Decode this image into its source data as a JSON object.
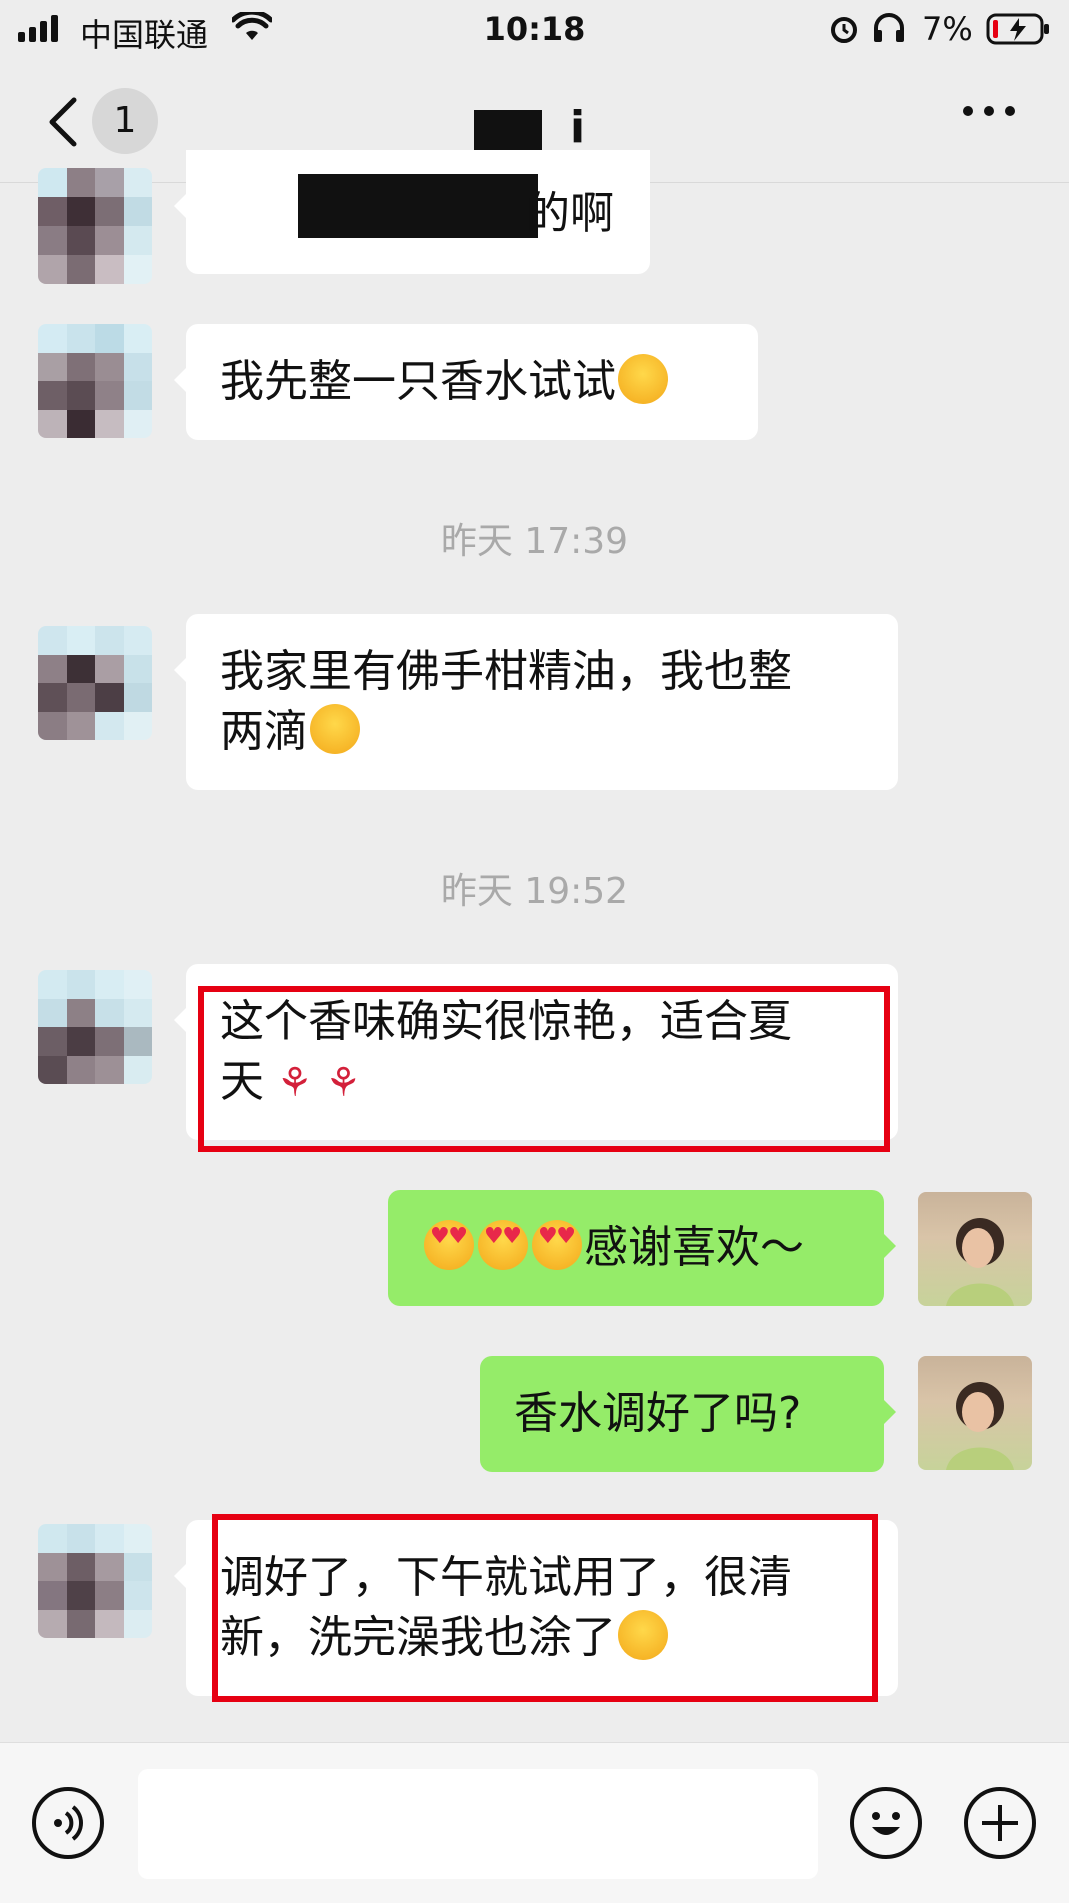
{
  "status_bar": {
    "carrier": "中国联通",
    "time": "10:18",
    "battery": "7%"
  },
  "nav": {
    "unread_count": "1",
    "title": "i",
    "more_label": "•••"
  },
  "messages": [
    {
      "side": "left",
      "text": "的啊",
      "redacted": true
    },
    {
      "side": "left",
      "text": "我先整一只香水试试",
      "emoji": "grin"
    },
    {
      "type": "time",
      "text": "昨天 17:39"
    },
    {
      "side": "left",
      "line1": "我家里有佛手柑精油，我也整",
      "line2": "两滴",
      "emoji": "grin"
    },
    {
      "type": "time",
      "text": "昨天 19:52"
    },
    {
      "side": "left",
      "line1": "这个香味确实很惊艳，适合夏",
      "line2": "天",
      "emoji": "rose",
      "highlighted": true
    },
    {
      "side": "right",
      "text": "感谢喜欢～",
      "emoji": "heart-eyes"
    },
    {
      "side": "right",
      "text": "香水调好了吗?"
    },
    {
      "side": "left",
      "line1": "调好了，下午就试用了，很清",
      "line2": "新，洗完澡我也涂了",
      "emoji": "thinking",
      "highlighted": true
    }
  ],
  "colors": {
    "background": "#ededed",
    "bubble_left": "#ffffff",
    "bubble_right": "#95ec69",
    "highlight": "#e60012"
  }
}
